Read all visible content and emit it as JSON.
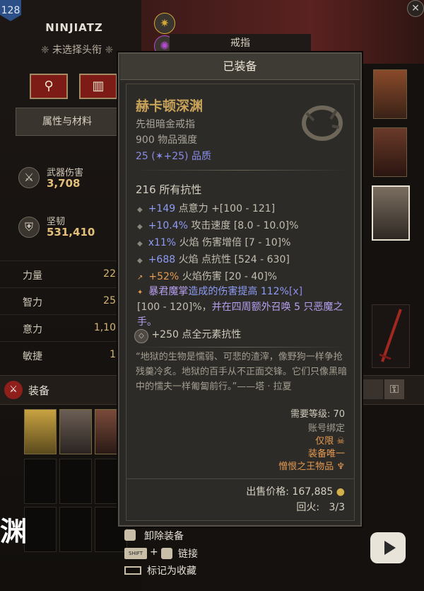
{
  "character": {
    "level": "128",
    "name": "NINJIATZ",
    "title": "未选择头衔",
    "tab_label": "属性与材料",
    "stats": [
      {
        "label": "武器伤害",
        "value": "3,708",
        "icon": "crossed-swords-icon"
      },
      {
        "label": "坚韧",
        "value": "531,410",
        "icon": "shield-icon"
      }
    ],
    "attributes": [
      {
        "name": "力量",
        "value": "22"
      },
      {
        "name": "智力",
        "value": "25"
      },
      {
        "name": "意力",
        "value": "1,10"
      },
      {
        "name": "敏捷",
        "value": "1"
      }
    ],
    "equip_label": "装备"
  },
  "watermark": "渊",
  "slot_header": "戒指",
  "tooltip": {
    "header": "已装备",
    "name": "赫卡顿深渊",
    "type": "先祖暗金戒指",
    "power": "900 物品强度",
    "quality_value": "25",
    "quality_bonus": "+25",
    "quality_label": "品质",
    "implicit": "216 所有抗性",
    "affixes": [
      {
        "value": "+149",
        "text": "点意力",
        "range": "+[100 - 121]"
      },
      {
        "value": "+10.4%",
        "text": "攻击速度",
        "range": "[8.0 - 10.0]%"
      },
      {
        "value": "x11%",
        "text": "火焰 伤害增倍",
        "range": "[7 - 10]%"
      },
      {
        "value": "+688",
        "text": "火焰 点抗性",
        "range": "[524 - 630]"
      },
      {
        "value": "+52%",
        "text": "火焰伤害",
        "range": "[20 - 40]%"
      }
    ],
    "legendary_1": "暴君魔掌",
    "legendary_2": "造成的伤害提高",
    "legendary_3": "112%",
    "legendary_4": "[x]",
    "legendary_5": "[100 - 120]%，",
    "legendary_6": "并在四周额外召唤 5 只恶魔之手。",
    "socket": "+250 点全元素抗性",
    "flavor": "“地狱的生物是懦弱、可悲的渣滓，像野狗一样争抢残羹冷炙。地狱的百手从不正面交锋。它们只像黑暗中的懦夫一样匍匐前行。”——塔 · 拉夏",
    "req_level": "需要等级: 70",
    "account_bound": "账号绑定",
    "only_label": "仅限",
    "unique_equipped": "装备唯一",
    "set_item": "憎恨之王物品",
    "sell_label": "出售价格:",
    "sell_value": "167,885",
    "recall_label": "回火:",
    "recall_value": "3/3"
  },
  "hints": {
    "unequip": "卸除装备",
    "shift_key": "SHIFT",
    "plus": "+",
    "link": "链接",
    "favorite": "标记为收藏"
  },
  "colors": {
    "legendary_gold": "#c9a35a",
    "affix_blue": "#8e9cf5",
    "affix_orange": "#e89a50",
    "unique_purple": "#b79ff0",
    "req_orange": "#e69a52"
  }
}
